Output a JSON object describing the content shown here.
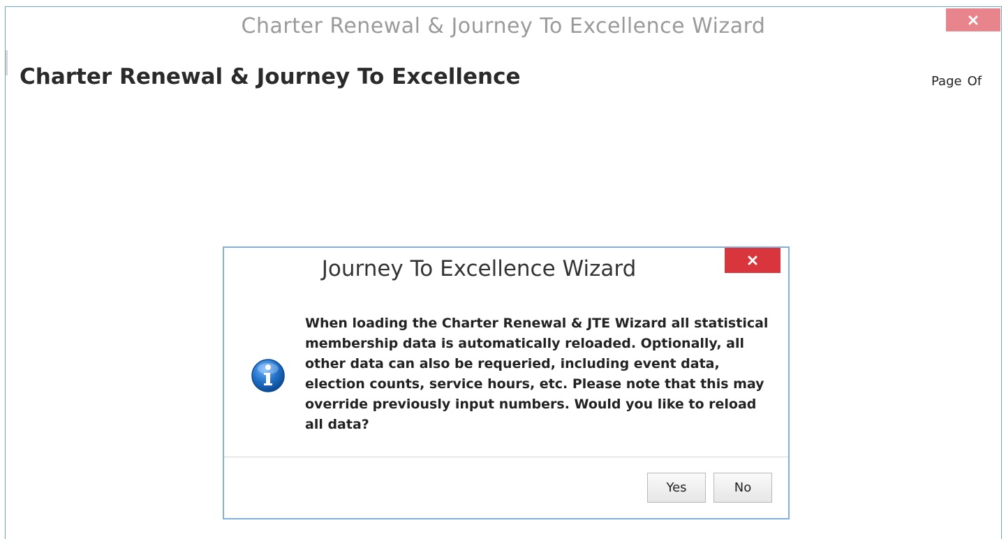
{
  "window": {
    "title": "Charter Renewal & Journey To Excellence Wizard",
    "close_icon": "close-icon"
  },
  "page": {
    "heading": "Charter Renewal & Journey To Excellence",
    "page_label": "Page",
    "of_label": "Of"
  },
  "dialog": {
    "title": "Journey To Excellence Wizard",
    "close_icon": "close-icon",
    "icon": "info-icon",
    "message": "When loading the Charter Renewal & JTE Wizard all statistical membership data is automatically reloaded. Optionally, all other data can also be requeried, including event data, election counts, service hours, etc. Please note that this may override previously input numbers. Would you like to reload all data?",
    "yes_label": "Yes",
    "no_label": "No"
  },
  "colors": {
    "window_border": "#6aa6d8",
    "window_close_bg": "#e8848b",
    "dialog_border": "#7fb0e0",
    "dialog_close_bg": "#d9353c",
    "info_icon": "#1f6fc5"
  }
}
